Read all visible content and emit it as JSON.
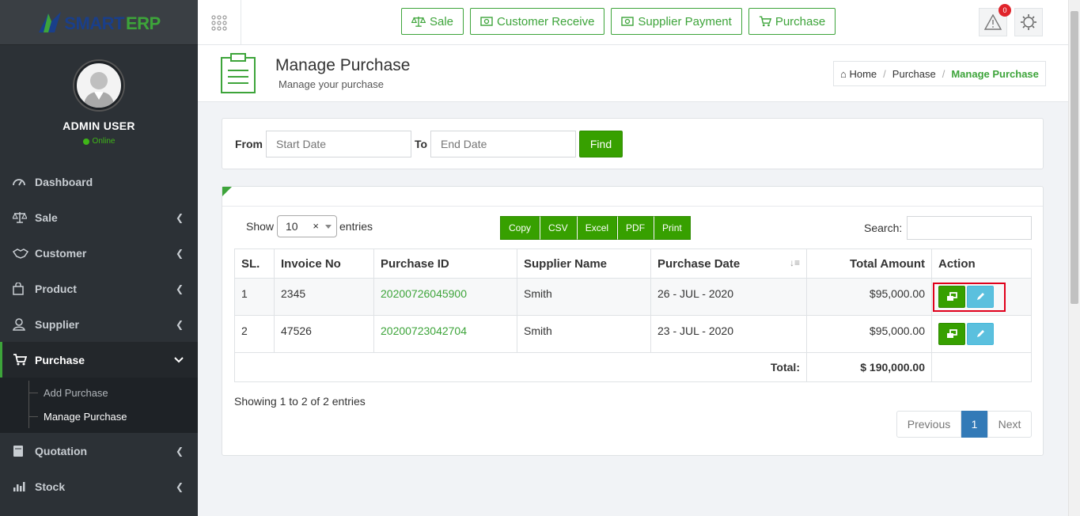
{
  "brand": {
    "smart": "SMART",
    "erp": "ERP"
  },
  "user": {
    "name": "ADMIN USER",
    "status": "Online"
  },
  "sidebar": {
    "items": [
      {
        "label": "Dashboard",
        "icon": "dashboard-icon"
      },
      {
        "label": "Sale",
        "icon": "scale-icon"
      },
      {
        "label": "Customer",
        "icon": "handshake-icon"
      },
      {
        "label": "Product",
        "icon": "bag-icon"
      },
      {
        "label": "Supplier",
        "icon": "user-icon"
      },
      {
        "label": "Purchase",
        "icon": "cart-icon"
      },
      {
        "label": "Quotation",
        "icon": "book-icon"
      },
      {
        "label": "Stock",
        "icon": "bar-chart-icon"
      }
    ],
    "purchase_sub": [
      "Add Purchase",
      "Manage Purchase"
    ]
  },
  "topbar": {
    "buttons": [
      "Sale",
      "Customer Receive",
      "Supplier Payment",
      "Purchase"
    ],
    "alert_count": "0"
  },
  "page": {
    "title": "Manage Purchase",
    "subtitle": "Manage your purchase",
    "breadcrumb": [
      "Home",
      "Purchase",
      "Manage Purchase"
    ]
  },
  "filter": {
    "from_label": "From",
    "to_label": "To",
    "start_placeholder": "Start Date",
    "end_placeholder": "End Date",
    "find_label": "Find"
  },
  "table_controls": {
    "show_label": "Show",
    "length_value": "10",
    "clear_mark": "×",
    "entries_label": "entries",
    "export": [
      "Copy",
      "CSV",
      "Excel",
      "PDF",
      "Print"
    ],
    "search_label": "Search:"
  },
  "table": {
    "headers": [
      "SL.",
      "Invoice No",
      "Purchase ID",
      "Supplier Name",
      "Purchase Date",
      "Total Amount",
      "Action"
    ],
    "rows": [
      {
        "sl": "1",
        "invoice": "2345",
        "purchase_id": "20200726045900",
        "supplier": "Smith",
        "date": "26 - JUL - 2020",
        "amount": "$95,000.00"
      },
      {
        "sl": "2",
        "invoice": "47526",
        "purchase_id": "20200723042704",
        "supplier": "Smith",
        "date": "23 - JUL - 2020",
        "amount": "$95,000.00"
      }
    ],
    "total_label": "Total:",
    "total_value": "$ 190,000.00"
  },
  "footer": {
    "showing": "Showing 1 to 2 of 2 entries",
    "pagination": [
      "Previous",
      "1",
      "Next"
    ]
  },
  "colors": {
    "accent": "#3da43a",
    "sidebar": "#2c3136",
    "primary": "#337ab7",
    "highlight": "#e0001b"
  }
}
